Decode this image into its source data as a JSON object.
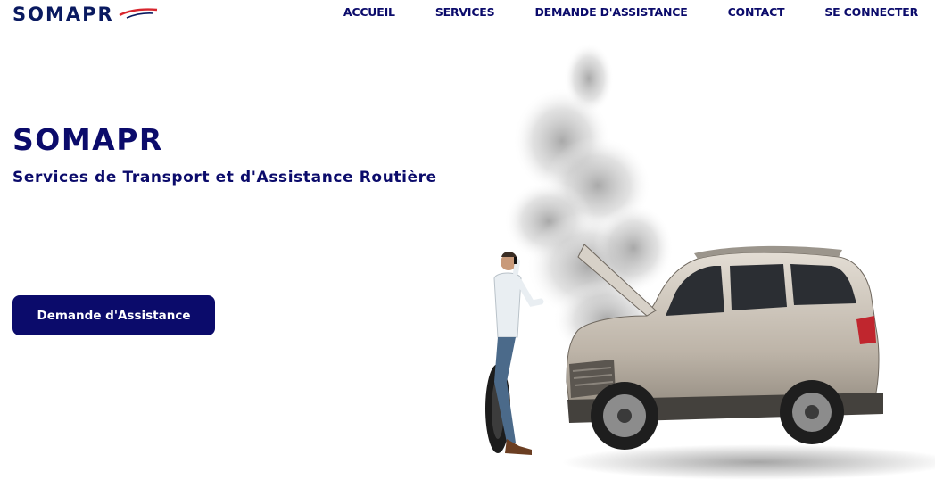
{
  "brand": {
    "logo_text": "SOMAP",
    "logo_tail": "R"
  },
  "nav": {
    "items": [
      {
        "label": "ACCUEIL"
      },
      {
        "label": "SERVICES"
      },
      {
        "label": "DEMANDE D'ASSISTANCE"
      },
      {
        "label": "CONTACT"
      },
      {
        "label": "SE CONNECTER"
      }
    ]
  },
  "hero": {
    "title": "SOMAPR",
    "subtitle": "Services de Transport et d'Assistance Routière",
    "cta_label": "Demande d'Assistance"
  },
  "colors": {
    "brand_navy": "#0b0b6b",
    "logo_red": "#d8262e",
    "background": "#ffffff"
  },
  "icons": {
    "hero_image": "broken-down-car-with-smoke-and-man-on-phone"
  }
}
